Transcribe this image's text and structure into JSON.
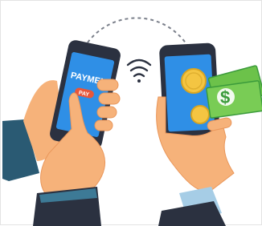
{
  "illustration": {
    "phone_left": {
      "title": "PAYMENT",
      "button": "PAY"
    },
    "phone_right": {
      "coin_icons": [
        "coin-icon",
        "coin-icon"
      ],
      "cash_icon": "dollar-bill-icon",
      "cash_symbol": "$"
    },
    "transfer_icons": [
      "wifi-icon",
      "dashed-arrow-icon"
    ]
  },
  "colors": {
    "phone_body": "#2b3140",
    "screen": "#2f8fe6",
    "pay_button": "#e8573a",
    "skin": "#f6b27a",
    "skin_shadow": "#e9965a",
    "sleeve_left": "#2a5a73",
    "sleeve_right": "#a6cde6",
    "coin": "#f4c542",
    "cash": "#6cc24a"
  }
}
